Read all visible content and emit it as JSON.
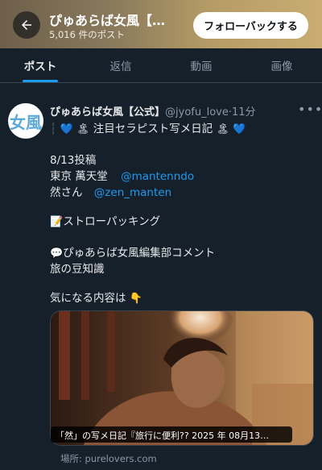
{
  "header": {
    "title": "ぴゅあらば女風【…",
    "post_count": "5,016 件のポスト",
    "follow_label": "フォローバックする"
  },
  "tabs": [
    {
      "label": "ポスト",
      "active": true
    },
    {
      "label": "返信",
      "active": false
    },
    {
      "label": "動画",
      "active": false
    },
    {
      "label": "画像",
      "active": false
    }
  ],
  "tweet": {
    "avatar_text": "女風",
    "name": "ぴゅあらば女風【公式】",
    "handle": "@jyofu_love",
    "time": "11分",
    "heading": "注目セラピスト写メ日記",
    "date_line": "8/13投稿",
    "shop_line": "東京 萬天堂",
    "shop_mention": "@mantenndo",
    "person_line": "然さん",
    "person_mention": "@zen_manten",
    "topic": "ストローパッキング",
    "comment_label": "ぴゅあらば女風編集部コメント",
    "comment_text": "旅の豆知識",
    "cta": "気になる内容は",
    "media_caption": "「然」の写メ日記『旅行に便利?? 2025 年 08月13…",
    "place": "場所: purelovers.com"
  },
  "icons": {
    "back": "arrow-left-icon",
    "heart": "blue-heart-emoji",
    "island": "island-emoji",
    "memo": "memo-emoji",
    "speech": "speech-bubble-emoji",
    "point": "pointing-down-emoji",
    "more": "more-dots-icon"
  },
  "colors": {
    "background": "#15202b",
    "accent": "#1d9bf0",
    "muted": "#8b98a5"
  }
}
